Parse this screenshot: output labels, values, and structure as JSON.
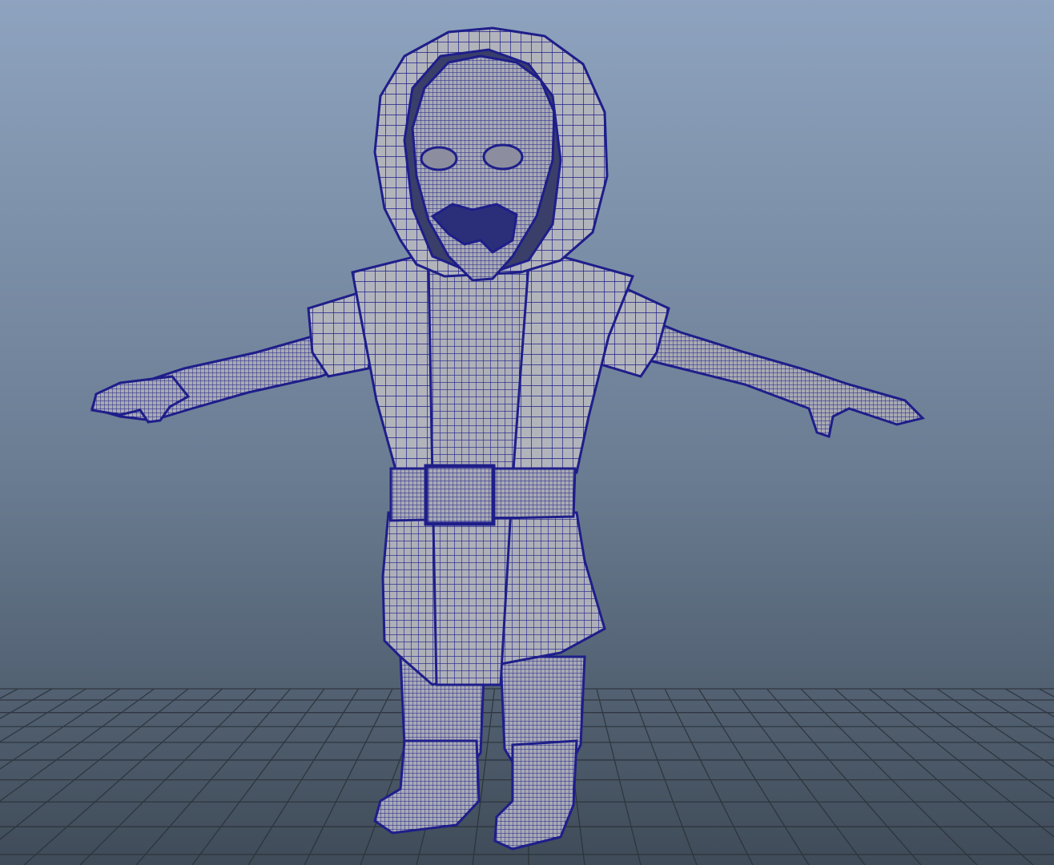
{
  "viewport": {
    "background_top": "#8ea3bf",
    "background_bottom": "#3f4b58",
    "grid_color": "#2a3138",
    "mesh_fill": "#aeb0b8",
    "mesh_wire": "#1e1e8a"
  },
  "scene": {
    "object": "character-mesh",
    "display_mode": "wireframe-on-shaded",
    "pose": "T-pose"
  }
}
